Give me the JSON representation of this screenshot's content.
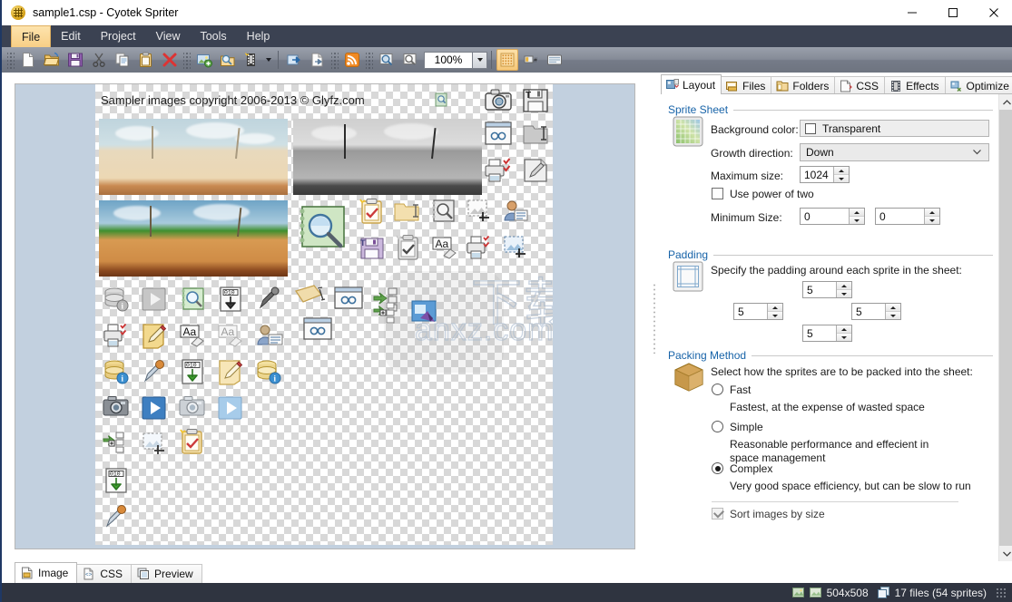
{
  "window": {
    "title": "sample1.csp - Cyotek Spriter",
    "app_icon": "spriter-app-icon",
    "minimize": "minimize-icon",
    "maximize": "maximize-icon",
    "close": "close-icon"
  },
  "menu": {
    "items": [
      {
        "label": "File",
        "active": true
      },
      {
        "label": "Edit",
        "active": false
      },
      {
        "label": "Project",
        "active": false
      },
      {
        "label": "View",
        "active": false
      },
      {
        "label": "Tools",
        "active": false
      },
      {
        "label": "Help",
        "active": false
      }
    ]
  },
  "toolbar": {
    "zoom_value": "100%",
    "buttons": [
      {
        "name": "new-file-icon",
        "title": "New"
      },
      {
        "name": "open-folder-icon",
        "title": "Open"
      },
      {
        "name": "save-floppy-icon",
        "title": "Save"
      },
      {
        "name": "cut-scissors-icon",
        "title": "Cut"
      },
      {
        "name": "copy-icon",
        "title": "Copy"
      },
      {
        "name": "paste-clipboard-icon",
        "title": "Paste"
      },
      {
        "name": "delete-x-icon",
        "title": "Delete"
      },
      {
        "name": "add-image-icon",
        "title": "Add image"
      },
      {
        "name": "browse-folder-icon",
        "title": "Add folder"
      },
      {
        "name": "film-strip-icon",
        "title": "Add animation"
      },
      {
        "name": "import-icon",
        "title": "Import"
      },
      {
        "name": "export-icon",
        "title": "Export"
      },
      {
        "name": "rss-feed-icon",
        "title": "News"
      },
      {
        "name": "zoom-preview-icon",
        "title": "Zoom preview"
      },
      {
        "name": "zoom-fit-icon",
        "title": "Zoom to fit"
      },
      {
        "name": "transparency-grid-icon",
        "title": "Show transparency grid"
      },
      {
        "name": "show-labels-icon",
        "title": "Show labels"
      },
      {
        "name": "show-panel-icon",
        "title": "Show details panel"
      }
    ]
  },
  "canvas": {
    "sheet_caption": "Sampler images copyright 2006-2013 © Glyfz.com",
    "sheet_size": "504x508",
    "watermark_text": "anxz.com",
    "watermark_cjk": "下载"
  },
  "right_panel": {
    "tabs": [
      {
        "label": "Layout",
        "icon": "layout-tab-icon",
        "active": true
      },
      {
        "label": "Files",
        "icon": "files-tab-icon",
        "active": false
      },
      {
        "label": "Folders",
        "icon": "folders-tab-icon",
        "active": false
      },
      {
        "label": "CSS",
        "icon": "css-tab-icon",
        "active": false
      },
      {
        "label": "Effects",
        "icon": "effects-tab-icon",
        "active": false
      },
      {
        "label": "Optimize",
        "icon": "optimize-tab-icon",
        "active": false
      }
    ],
    "sprite_sheet": {
      "title": "Sprite Sheet",
      "icon": "sprite-sheet-icon",
      "background_color_label": "Background color:",
      "background_color_value": "Transparent",
      "growth_direction_label": "Growth direction:",
      "growth_direction_value": "Down",
      "maximum_size_label": "Maximum size:",
      "maximum_size_value": "1024",
      "use_power_of_two_label": "Use power of two",
      "use_power_of_two_checked": false,
      "minimum_size_label": "Minimum Size:",
      "minimum_size_width": "0",
      "minimum_size_height": "0"
    },
    "padding": {
      "title": "Padding",
      "icon": "padding-icon",
      "description": "Specify the padding around each sprite in the sheet:",
      "top": "5",
      "left": "5",
      "right": "5",
      "bottom": "5"
    },
    "packing": {
      "title": "Packing Method",
      "icon": "package-box-icon",
      "description": "Select how the sprites are to be packed into the sheet:",
      "options": [
        {
          "label": "Fast",
          "description": "Fastest, at the expense of wasted space",
          "selected": false
        },
        {
          "label": "Simple",
          "description": "Reasonable performance and effecient in space management",
          "selected": false
        },
        {
          "label": "Complex",
          "description": "Very good space efficiency, but can be slow to run",
          "selected": true
        }
      ],
      "sort_label": "Sort images by size",
      "sort_checked": true,
      "sort_disabled": true
    }
  },
  "bottom_tabs": [
    {
      "label": "Image",
      "icon": "image-tab-icon",
      "active": true
    },
    {
      "label": "CSS",
      "icon": "css-code-icon",
      "active": false
    },
    {
      "label": "Preview",
      "icon": "preview-tab-icon",
      "active": false
    }
  ],
  "status_bar": {
    "dimensions_icon": "image-size-icon",
    "dimensions": "504x508",
    "files_icon": "stacked-files-icon",
    "files": "17 files (54 sprites)"
  },
  "colors": {
    "titlebar_bg": "#ffffff",
    "menu_bg": "#3b4252",
    "menu_active": "#f8cf86",
    "toolbar_bg": "#858b97",
    "status_bg": "#2f3440",
    "group_title": "#1763a8",
    "canvas_bg": "#c2d0df"
  }
}
